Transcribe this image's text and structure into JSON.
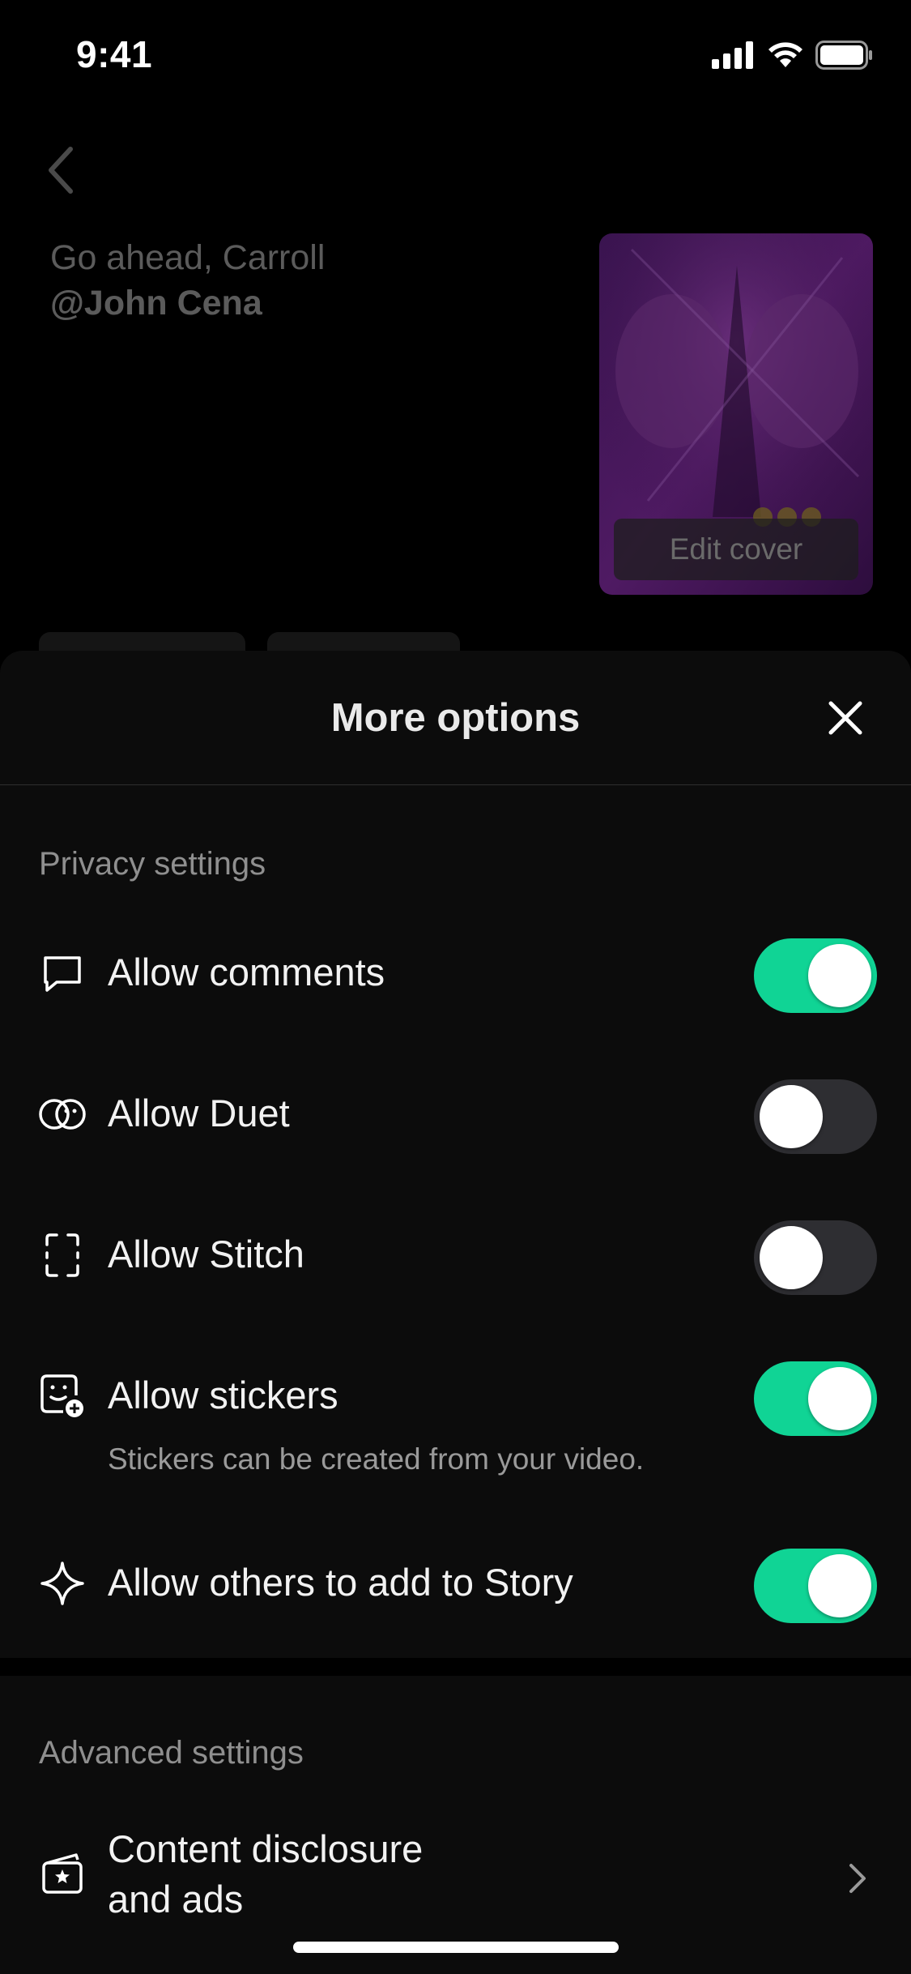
{
  "status_bar": {
    "time": "9:41",
    "icons": [
      "cellular-signal-icon",
      "wifi-icon",
      "battery-icon"
    ]
  },
  "background": {
    "caption_line1": "Go ahead, Carroll",
    "caption_mention": "@John Cena",
    "cover_button": "Edit cover"
  },
  "sheet": {
    "title": "More options",
    "privacy_label": "Privacy settings",
    "options": [
      {
        "label": "Allow comments",
        "icon": "comment-icon",
        "enabled": true
      },
      {
        "label": "Allow Duet",
        "icon": "duet-icon",
        "enabled": false
      },
      {
        "label": "Allow Stitch",
        "icon": "stitch-icon",
        "enabled": false
      },
      {
        "label": "Allow stickers",
        "sub": "Stickers can be created from your video.",
        "icon": "sticker-add-icon",
        "enabled": true
      },
      {
        "label": "Allow others to add to Story",
        "icon": "sparkle-icon",
        "enabled": true
      }
    ],
    "advanced_label": "Advanced settings",
    "advanced_item": {
      "label_line1": "Content disclosure",
      "label_line2": "and ads",
      "icon": "disclosure-badge-icon"
    }
  },
  "colors": {
    "toggle_on": "#10d495",
    "toggle_off": "#2e2e32",
    "sheet_bg": "#0c0c0c"
  }
}
